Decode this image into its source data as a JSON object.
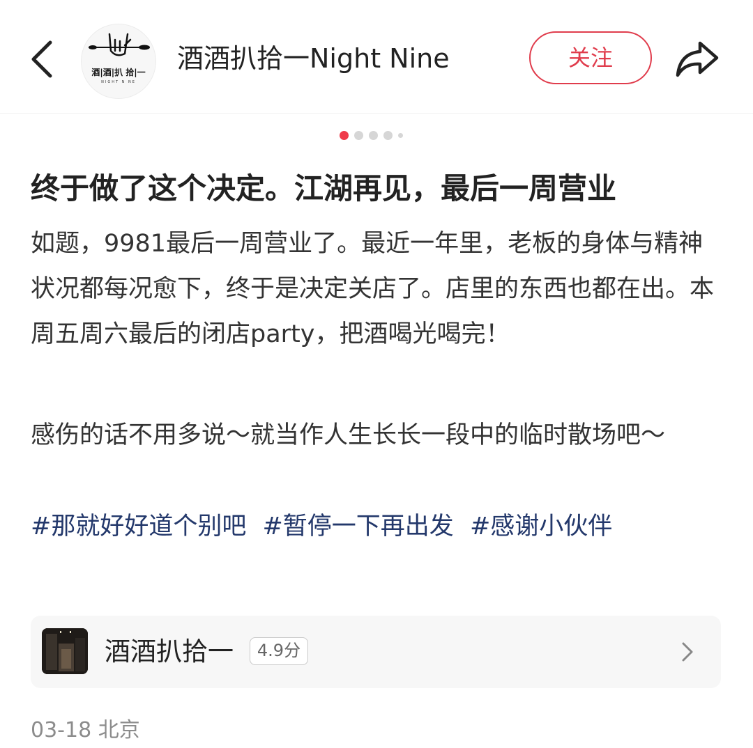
{
  "header": {
    "author_name": "酒酒扒拾一Night Nine",
    "avatar_logo_text": "酒|酒|扒 拾|一",
    "avatar_logo_sub": "NIGHT N NE",
    "follow_label": "关注"
  },
  "carousel": {
    "total": 5,
    "active_index": 0
  },
  "post": {
    "title": "终于做了这个决定。江湖再见，最后一周营业",
    "paragraph1": "如题，9981最后一周营业了。最近一年里，老板的身体与精神状况都每况愈下，终于是决定关店了。店里的东西也都在出。本周五周六最后的闭店party，把酒喝光喝完！",
    "paragraph2": "感伤的话不用多说～就当作人生长长一段中的临时散场吧～",
    "tags": [
      "#那就好好道个别吧",
      "#暂停一下再出发",
      "#感谢小伙伴"
    ]
  },
  "poi": {
    "name": "酒酒扒拾一",
    "rating": "4.9分"
  },
  "meta": {
    "date_location": "03-18 北京"
  },
  "colors": {
    "accent": "#e03c4c",
    "tag": "#23386b",
    "meta": "#8c8c8c"
  },
  "icons": {
    "back": "chevron-left-icon",
    "share": "share-arrow-icon",
    "poi_arrow": "chevron-right-icon"
  }
}
